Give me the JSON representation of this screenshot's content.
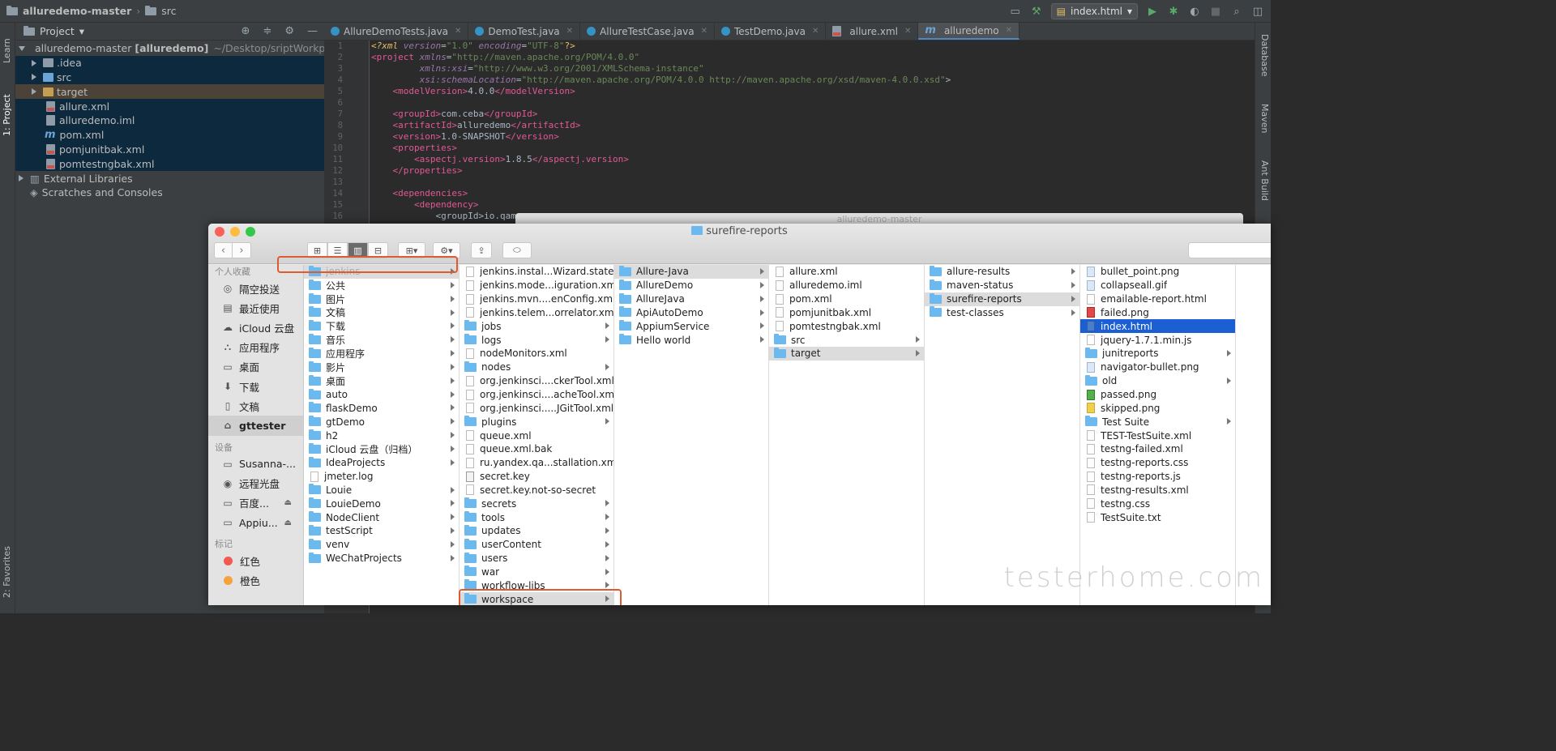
{
  "ide": {
    "breadcrumb": {
      "project": "alluredemo-master",
      "folder": "src"
    },
    "run_config": "index.html",
    "left_strip": {
      "learn": "Learn",
      "project": "1: Project",
      "favorites": "2: Favorites"
    },
    "right_strip": {
      "database": "Database",
      "maven": "Maven",
      "ant": "Ant Build"
    },
    "project_panel": {
      "title": "Project",
      "root": {
        "name": "alluredemo-master",
        "module": "[alluredemo]",
        "path": "~/Desktop/sriptWorkpace"
      },
      "items": [
        {
          "label": ".idea",
          "kind": "folder-gray"
        },
        {
          "label": "src",
          "kind": "folder-blue"
        },
        {
          "label": "target",
          "kind": "folder-orange"
        },
        {
          "label": "allure.xml",
          "kind": "xml"
        },
        {
          "label": "alluredemo.iml",
          "kind": "iml"
        },
        {
          "label": "pom.xml",
          "kind": "maven"
        },
        {
          "label": "pomjunitbak.xml",
          "kind": "xml"
        },
        {
          "label": "pomtestngbak.xml",
          "kind": "xml"
        }
      ],
      "external": "External Libraries",
      "scratches": "Scratches and Consoles"
    },
    "tabs": [
      "AllureDemoTests.java",
      "DemoTest.java",
      "AllureTestCase.java",
      "TestDemo.java",
      "allure.xml",
      "alluredemo"
    ],
    "code": {
      "decl": {
        "tag": "?xml",
        "version_attr": "version",
        "version_val": "\"1.0\"",
        "enc_attr": "encoding",
        "enc_val": "\"UTF-8\""
      },
      "project_tag": "project",
      "xmlns_attr": "xmlns",
      "xmlns_val": "\"http://maven.apache.org/POM/4.0.0\"",
      "xsi_attr": "xmlns:xsi",
      "xsi_val": "\"http://www.w3.org/2001/XMLSchema-instance\"",
      "schema_attr": "xsi:schemaLocation",
      "schema_val": "\"http://maven.apache.org/POM/4.0.0 http://maven.apache.org/xsd/maven-4.0.0.xsd\"",
      "model_tag": "modelVersion",
      "model_val": "4.0.0",
      "group_tag": "groupId",
      "group_val": "com.ceba",
      "artifact_tag": "artifactId",
      "artifact_val": "alluredemo",
      "version_tag": "version",
      "version_val": "1.0-SNAPSHOT",
      "props_tag": "properties",
      "aspect_tag": "aspectj.version",
      "aspect_val": "1.8.5",
      "deps_tag": "dependencies",
      "dep_tag": "dependency",
      "line16": "<groupId>io.qam",
      "line_numbers": [
        "1",
        "2",
        "3",
        "4",
        "5",
        "6",
        "7",
        "8",
        "9",
        "10",
        "11",
        "12",
        "13",
        "14",
        "15",
        "16"
      ]
    }
  },
  "finder": {
    "title": "surefire-reports",
    "behind_title": "alluredemo-master",
    "sidebar": {
      "favorites_header": "个人收藏",
      "favorites": [
        {
          "label": "隔空投送",
          "icon": "airdrop-icon"
        },
        {
          "label": "最近使用",
          "icon": "recents-icon"
        },
        {
          "label": "iCloud 云盘",
          "icon": "icloud-icon"
        },
        {
          "label": "应用程序",
          "icon": "applications-icon"
        },
        {
          "label": "桌面",
          "icon": "desktop-icon"
        },
        {
          "label": "下载",
          "icon": "downloads-icon"
        },
        {
          "label": "文稿",
          "icon": "documents-icon"
        },
        {
          "label": "gttester",
          "icon": "home-icon"
        }
      ],
      "devices_header": "设备",
      "devices": [
        {
          "label": "Susanna-...",
          "icon": "laptop-icon"
        },
        {
          "label": "远程光盘",
          "icon": "disc-icon"
        },
        {
          "label": "百度...",
          "icon": "drive-icon"
        },
        {
          "label": "Appiu...",
          "icon": "drive-icon"
        }
      ],
      "tags_header": "标记",
      "tags": [
        {
          "label": "红色",
          "color": "#f25a51"
        },
        {
          "label": "橙色",
          "color": "#f6a23b"
        }
      ]
    },
    "columns": [
      {
        "items": [
          {
            "n": "jenkins",
            "t": "folder",
            "sel": "gray",
            "dim": true
          },
          {
            "n": "公共",
            "t": "folder"
          },
          {
            "n": "图片",
            "t": "folder"
          },
          {
            "n": "文稿",
            "t": "folder"
          },
          {
            "n": "下载",
            "t": "folder"
          },
          {
            "n": "音乐",
            "t": "folder"
          },
          {
            "n": "应用程序",
            "t": "folder"
          },
          {
            "n": "影片",
            "t": "folder"
          },
          {
            "n": "桌面",
            "t": "folder"
          },
          {
            "n": "auto",
            "t": "folder"
          },
          {
            "n": "flaskDemo",
            "t": "folder"
          },
          {
            "n": "gtDemo",
            "t": "folder"
          },
          {
            "n": "h2",
            "t": "folder"
          },
          {
            "n": "iCloud 云盘（归档）",
            "t": "folder"
          },
          {
            "n": "IdeaProjects",
            "t": "folder"
          },
          {
            "n": "jmeter.log",
            "t": "file"
          },
          {
            "n": "Louie",
            "t": "folder"
          },
          {
            "n": "LouieDemo",
            "t": "folder"
          },
          {
            "n": "NodeClient",
            "t": "folder"
          },
          {
            "n": "testScript",
            "t": "folder"
          },
          {
            "n": "venv",
            "t": "folder"
          },
          {
            "n": "WeChatProjects",
            "t": "folder"
          }
        ]
      },
      {
        "items": [
          {
            "n": "jenkins.instal...Wizard.state",
            "t": "file"
          },
          {
            "n": "jenkins.mode...iguration.xml",
            "t": "file"
          },
          {
            "n": "jenkins.mvn....enConfig.xml",
            "t": "file"
          },
          {
            "n": "jenkins.telem...orrelator.xml",
            "t": "file"
          },
          {
            "n": "jobs",
            "t": "folder"
          },
          {
            "n": "logs",
            "t": "folder"
          },
          {
            "n": "nodeMonitors.xml",
            "t": "file"
          },
          {
            "n": "nodes",
            "t": "folder"
          },
          {
            "n": "org.jenkinsci....ckerTool.xml",
            "t": "file"
          },
          {
            "n": "org.jenkinsci....acheTool.xml",
            "t": "file"
          },
          {
            "n": "org.jenkinsci.....JGitTool.xml",
            "t": "file"
          },
          {
            "n": "plugins",
            "t": "folder"
          },
          {
            "n": "queue.xml",
            "t": "file"
          },
          {
            "n": "queue.xml.bak",
            "t": "file"
          },
          {
            "n": "ru.yandex.qa...stallation.xml",
            "t": "file"
          },
          {
            "n": "secret.key",
            "t": "key"
          },
          {
            "n": "secret.key.not-so-secret",
            "t": "file"
          },
          {
            "n": "secrets",
            "t": "folder"
          },
          {
            "n": "tools",
            "t": "folder"
          },
          {
            "n": "updates",
            "t": "folder"
          },
          {
            "n": "userContent",
            "t": "folder"
          },
          {
            "n": "users",
            "t": "folder"
          },
          {
            "n": "war",
            "t": "folder"
          },
          {
            "n": "workflow-libs",
            "t": "folder"
          },
          {
            "n": "workspace",
            "t": "folder",
            "sel": "gray"
          }
        ]
      },
      {
        "items": [
          {
            "n": "Allure-Java",
            "t": "folder",
            "sel": "gray"
          },
          {
            "n": "AllureDemo",
            "t": "folder"
          },
          {
            "n": "AllureJava",
            "t": "folder"
          },
          {
            "n": "ApiAutoDemo",
            "t": "folder"
          },
          {
            "n": "AppiumService",
            "t": "folder"
          },
          {
            "n": "Hello world",
            "t": "folder"
          }
        ]
      },
      {
        "items": [
          {
            "n": "allure.xml",
            "t": "file"
          },
          {
            "n": "alluredemo.iml",
            "t": "file"
          },
          {
            "n": "pom.xml",
            "t": "file"
          },
          {
            "n": "pomjunitbak.xml",
            "t": "file"
          },
          {
            "n": "pomtestngbak.xml",
            "t": "file"
          },
          {
            "n": "src",
            "t": "folder"
          },
          {
            "n": "target",
            "t": "folder",
            "sel": "gray"
          }
        ]
      },
      {
        "items": [
          {
            "n": "allure-results",
            "t": "folder"
          },
          {
            "n": "maven-status",
            "t": "folder"
          },
          {
            "n": "surefire-reports",
            "t": "folder",
            "sel": "gray"
          },
          {
            "n": "test-classes",
            "t": "folder"
          }
        ]
      },
      {
        "items": [
          {
            "n": "bullet_point.png",
            "t": "png"
          },
          {
            "n": "collapseall.gif",
            "t": "png"
          },
          {
            "n": "emailable-report.html",
            "t": "file"
          },
          {
            "n": "failed.png",
            "t": "red"
          },
          {
            "n": "index.html",
            "t": "blue",
            "sel": "blue"
          },
          {
            "n": "jquery-1.7.1.min.js",
            "t": "file"
          },
          {
            "n": "junitreports",
            "t": "folder"
          },
          {
            "n": "navigator-bullet.png",
            "t": "png"
          },
          {
            "n": "old",
            "t": "folder"
          },
          {
            "n": "passed.png",
            "t": "green"
          },
          {
            "n": "skipped.png",
            "t": "yellow"
          },
          {
            "n": "Test Suite",
            "t": "folder"
          },
          {
            "n": "TEST-TestSuite.xml",
            "t": "file"
          },
          {
            "n": "testng-failed.xml",
            "t": "file"
          },
          {
            "n": "testng-reports.css",
            "t": "file"
          },
          {
            "n": "testng-reports.js",
            "t": "file"
          },
          {
            "n": "testng-results.xml",
            "t": "file"
          },
          {
            "n": "testng.css",
            "t": "file"
          },
          {
            "n": "TestSuite.txt",
            "t": "file"
          }
        ]
      }
    ],
    "highlight_color": "#e05a2f"
  },
  "watermark": "testerhome.com"
}
